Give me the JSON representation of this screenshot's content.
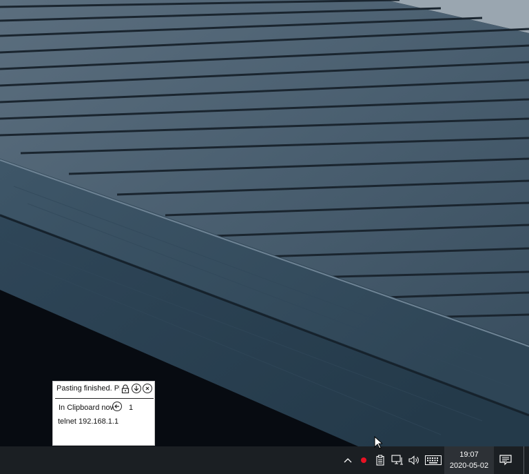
{
  "popup": {
    "title": "Pasting finished. Pl",
    "clipboard_label": "In Clipboard now:",
    "clipboard_count": "1",
    "clipboard_entry": "telnet 192.168.1.1"
  },
  "taskbar": {
    "time": "19:07",
    "date": "2020-05-02",
    "tray_icons": [
      "chevron-up-icon",
      "red-dot-icon",
      "clipboard-icon",
      "network-icon",
      "volume-icon",
      "keyboard-icon",
      "notification-icon"
    ]
  },
  "colors": {
    "taskbar": "#1b1f23",
    "clock_bg": "#2d3136",
    "record_dot": "#e81123"
  }
}
